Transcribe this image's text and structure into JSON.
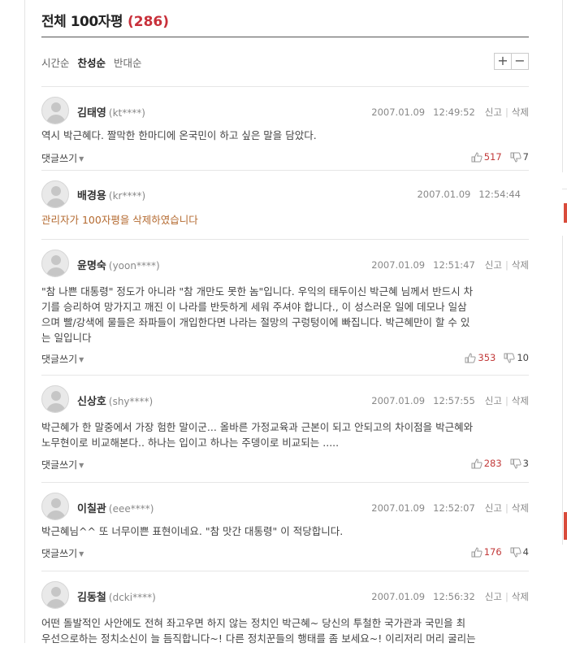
{
  "header": {
    "title": "전체 100자평",
    "count": "(286)"
  },
  "sort": {
    "tabs": [
      "시간순",
      "찬성순",
      "반대순"
    ],
    "active": "찬성순",
    "zoom_in": "+",
    "zoom_out": "−"
  },
  "labels": {
    "reply": "댓글쓰기",
    "report": "신고",
    "delete": "삭제"
  },
  "comments": [
    {
      "name": "김태영",
      "uid": "(kt****)",
      "date": "2007.01.09",
      "time": "12:49:52",
      "text": "역시 박근혜다. 짤막한 한마디에 온국민이 하고 싶은 말을 담았다.",
      "up": "517",
      "down": "7"
    },
    {
      "name": "배경용",
      "uid": "(kr****)",
      "date": "2007.01.09",
      "time": "12:54:44",
      "text": "관리자가 100자평을 삭제하였습니다"
    },
    {
      "name": "윤명숙",
      "uid": "(yoon****)",
      "date": "2007.01.09",
      "time": "12:51:47",
      "text_lines": [
        "\"참 나쁜 대통령\" 정도가 아니라 \"참 개만도 못한 놈\"입니다. 우익의 태두이신 박근혜 님께서 반드시 차",
        "기를 승리하여 망가지고 깨진 이 나라를 반듯하게 세워 주셔야 합니다., 이 성스러운 일에 데모나 일삼",
        "으며 빨/강색에 물들은 좌파들이 개입한다면 나라는 절망의 구렁텅이에 빠집니다. 박근혜만이 할 수 있",
        "는 일입니다"
      ],
      "up": "353",
      "down": "10"
    },
    {
      "name": "신상호",
      "uid": "(shy****)",
      "date": "2007.01.09",
      "time": "12:57:55",
      "text_lines": [
        "박근혜가 한 말중에서 가장 험한 말이군... 올바른 가정교육과 근본이 되고 안되고의 차이점을 박근혜와",
        "노무현이로 비교해본다.. 하나는 입이고 하나는 주뎅이로 비교되는 ....."
      ],
      "up": "283",
      "down": "3"
    },
    {
      "name": "이칠관",
      "uid": "(eee****)",
      "date": "2007.01.09",
      "time": "12:52:07",
      "text": "박근혜님^^ 또 너무이쁜 표현이네요. \"참 맛간 대통령\" 이 적당합니다.",
      "up": "176",
      "down": "4"
    },
    {
      "name": "김동철",
      "uid": "(dcki****)",
      "date": "2007.01.09",
      "time": "12:56:32",
      "text_lines": [
        "어떤 돌발적인 사안에도 전혀 좌고우면 하지 않는 정치인 박근혜~ 당신의 투철한 국가관과 국민을 최",
        "우선으로하는 정치소신이 늘 듬직합니다~! 다른 정치꾼들의 행태를 좀 보세요~! 이리저리 머리 굴리는"
      ]
    }
  ]
}
